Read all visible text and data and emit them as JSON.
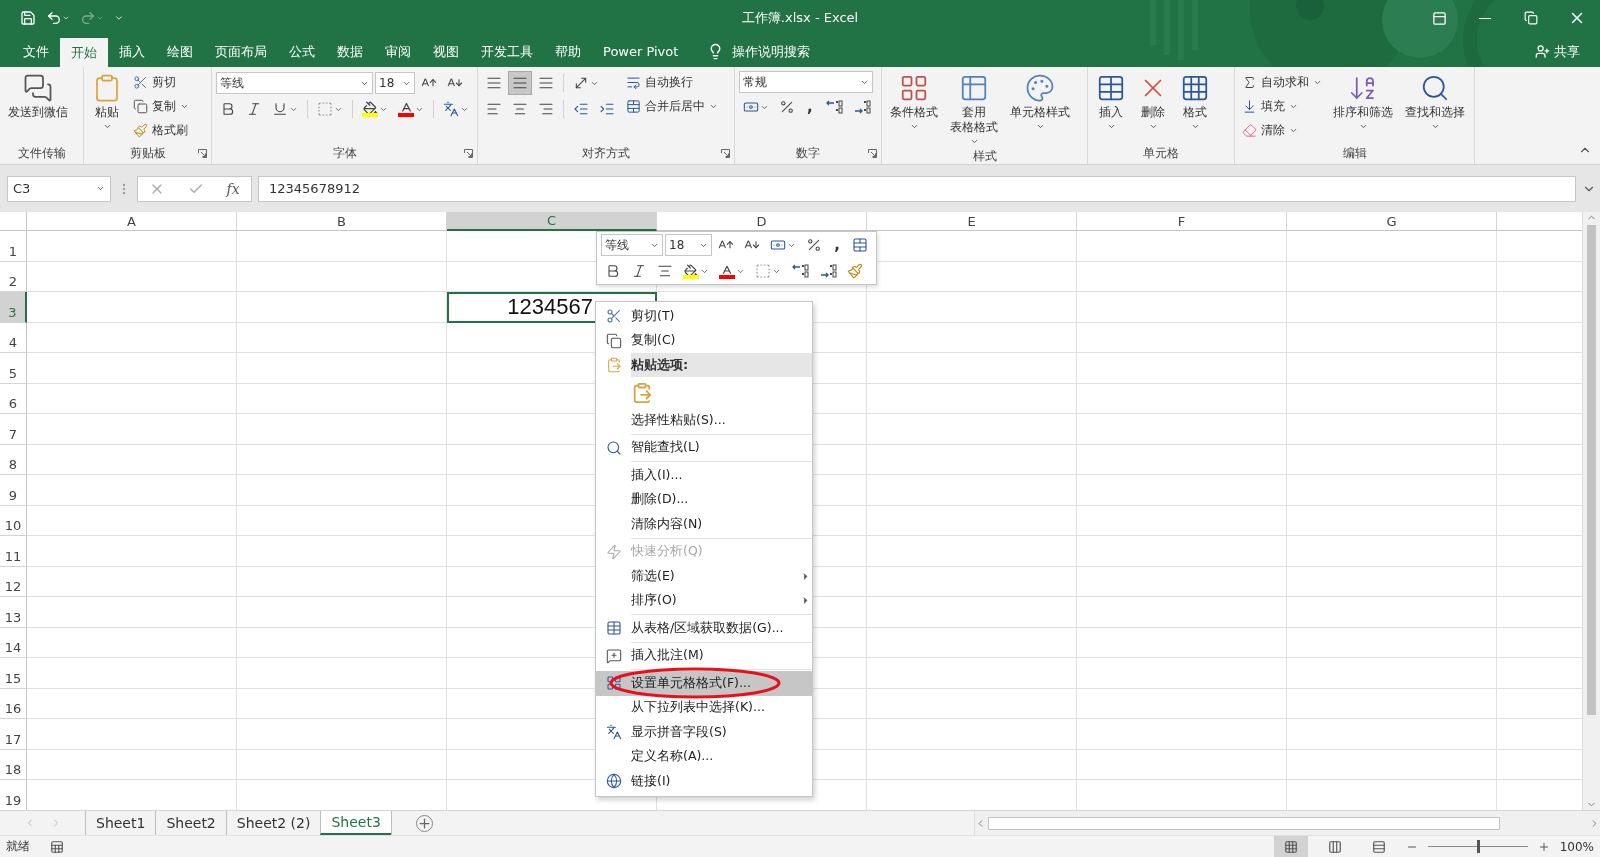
{
  "window": {
    "title": "工作簿.xlsx - Excel"
  },
  "quick_access": [
    {
      "kind": "save",
      "disabled": false
    },
    {
      "kind": "undo",
      "disabled": false
    },
    {
      "kind": "redo",
      "disabled": true
    },
    {
      "kind": "customize",
      "disabled": false
    }
  ],
  "ribbon_tabs": [
    {
      "label": "文件",
      "selected": false
    },
    {
      "label": "开始",
      "selected": true
    },
    {
      "label": "插入",
      "selected": false
    },
    {
      "label": "绘图",
      "selected": false
    },
    {
      "label": "页面布局",
      "selected": false
    },
    {
      "label": "公式",
      "selected": false
    },
    {
      "label": "数据",
      "selected": false
    },
    {
      "label": "审阅",
      "selected": false
    },
    {
      "label": "视图",
      "selected": false
    },
    {
      "label": "开发工具",
      "selected": false
    },
    {
      "label": "帮助",
      "selected": false
    },
    {
      "label": "Power Pivot",
      "selected": false
    }
  ],
  "tell_me": "操作说明搜索",
  "share": "共享",
  "ribbon_groups": [
    {
      "label": "文件传输",
      "launcher": false,
      "buttons": [
        "发送到微信"
      ]
    },
    {
      "label": "剪贴板",
      "launcher": true,
      "buttons": [
        "粘贴",
        "剪切",
        "复制",
        "格式刷"
      ]
    },
    {
      "label": "字体",
      "launcher": true,
      "font_name": "等线",
      "font_size": "18"
    },
    {
      "label": "对齐方式",
      "launcher": true,
      "buttons": [
        "自动换行",
        "合并后居中"
      ],
      "vertical_align": [
        {
          "selected": false
        },
        {
          "selected": true
        },
        {
          "selected": false
        }
      ]
    },
    {
      "label": "数字",
      "launcher": true,
      "format": "常规",
      "comma": ","
    },
    {
      "label": "样式",
      "launcher": false,
      "buttons": [
        "条件格式",
        {
          "lines": [
            "套用",
            "表格格式"
          ]
        },
        "单元格样式"
      ]
    },
    {
      "label": "单元格",
      "launcher": false,
      "buttons": [
        "插入",
        "删除",
        "格式"
      ]
    },
    {
      "label": "编辑",
      "launcher": false,
      "buttons": [
        "自动求和",
        "填充",
        "清除",
        "排序和筛选",
        "查找和选择"
      ]
    }
  ],
  "formula_bar": {
    "name_box": "C3",
    "fx": "fx",
    "value": "12345678912"
  },
  "columns": [
    {
      "label": "A",
      "selected": false
    },
    {
      "label": "B",
      "selected": false
    },
    {
      "label": "C",
      "selected": true
    },
    {
      "label": "D",
      "selected": false
    },
    {
      "label": "E",
      "selected": false
    },
    {
      "label": "F",
      "selected": false
    },
    {
      "label": "G",
      "selected": false
    }
  ],
  "rows": [
    {
      "label": "1",
      "selected": false
    },
    {
      "label": "2",
      "selected": false
    },
    {
      "label": "3",
      "selected": true
    },
    {
      "label": "4",
      "selected": false
    },
    {
      "label": "5",
      "selected": false
    },
    {
      "label": "6",
      "selected": false
    },
    {
      "label": "7",
      "selected": false
    },
    {
      "label": "8",
      "selected": false
    },
    {
      "label": "9",
      "selected": false
    },
    {
      "label": "10",
      "selected": false
    },
    {
      "label": "11",
      "selected": false
    },
    {
      "label": "12",
      "selected": false
    },
    {
      "label": "13",
      "selected": false
    },
    {
      "label": "14",
      "selected": false
    },
    {
      "label": "15",
      "selected": false
    },
    {
      "label": "16",
      "selected": false
    },
    {
      "label": "17",
      "selected": false
    },
    {
      "label": "18",
      "selected": false
    },
    {
      "label": "19",
      "selected": false
    }
  ],
  "active_cell": {
    "text": "1234567"
  },
  "mini_toolbar": {
    "font_name": "等线",
    "font_size": "18",
    "comma": ","
  },
  "context_menu": [
    {
      "kind": "item",
      "label": "剪切(T)",
      "disabled": false,
      "submenu": false,
      "selected": false
    },
    {
      "kind": "item",
      "label": "复制(C)",
      "disabled": false,
      "submenu": false,
      "selected": false
    },
    {
      "kind": "header",
      "label": "粘贴选项:"
    },
    {
      "kind": "paste_option"
    },
    {
      "kind": "item",
      "label": "选择性粘贴(S)...",
      "disabled": false,
      "submenu": false,
      "selected": false
    },
    {
      "kind": "separator"
    },
    {
      "kind": "item",
      "label": "智能查找(L)",
      "disabled": false,
      "submenu": false,
      "selected": false
    },
    {
      "kind": "separator"
    },
    {
      "kind": "item",
      "label": "插入(I)...",
      "disabled": false,
      "submenu": false,
      "selected": false
    },
    {
      "kind": "item",
      "label": "删除(D)...",
      "disabled": false,
      "submenu": false,
      "selected": false
    },
    {
      "kind": "item",
      "label": "清除内容(N)",
      "disabled": false,
      "submenu": false,
      "selected": false
    },
    {
      "kind": "separator"
    },
    {
      "kind": "item",
      "label": "快速分析(Q)",
      "disabled": true,
      "submenu": false,
      "selected": false
    },
    {
      "kind": "item",
      "label": "筛选(E)",
      "disabled": false,
      "submenu": true,
      "selected": false
    },
    {
      "kind": "item",
      "label": "排序(O)",
      "disabled": false,
      "submenu": true,
      "selected": false
    },
    {
      "kind": "separator"
    },
    {
      "kind": "item",
      "label": "从表格/区域获取数据(G)...",
      "disabled": false,
      "submenu": false,
      "selected": false
    },
    {
      "kind": "separator"
    },
    {
      "kind": "item",
      "label": "插入批注(M)",
      "disabled": false,
      "submenu": false,
      "selected": false
    },
    {
      "kind": "separator"
    },
    {
      "kind": "item",
      "label": "设置单元格格式(F)...",
      "disabled": false,
      "submenu": false,
      "selected": true
    },
    {
      "kind": "item",
      "label": "从下拉列表中选择(K)...",
      "disabled": false,
      "submenu": false,
      "selected": false
    },
    {
      "kind": "item",
      "label": "显示拼音字段(S)",
      "disabled": false,
      "submenu": false,
      "selected": false
    },
    {
      "kind": "item",
      "label": "定义名称(A)...",
      "disabled": false,
      "submenu": false,
      "selected": false
    },
    {
      "kind": "item",
      "label": "链接(I)",
      "disabled": false,
      "submenu": false,
      "selected": false
    }
  ],
  "sheet_tabs": [
    {
      "label": "Sheet1",
      "selected": false
    },
    {
      "label": "Sheet2",
      "selected": false
    },
    {
      "label": "Sheet2 (2)",
      "selected": false
    },
    {
      "label": "Sheet3",
      "selected": true
    }
  ],
  "status_bar": {
    "status": "就绪",
    "views": [
      {
        "kind": "normal",
        "selected": true
      },
      {
        "kind": "page_layout",
        "selected": false
      },
      {
        "kind": "page_break",
        "selected": false
      }
    ],
    "zoom_slider": {
      "level": 0.5
    },
    "zoom": "100%"
  }
}
